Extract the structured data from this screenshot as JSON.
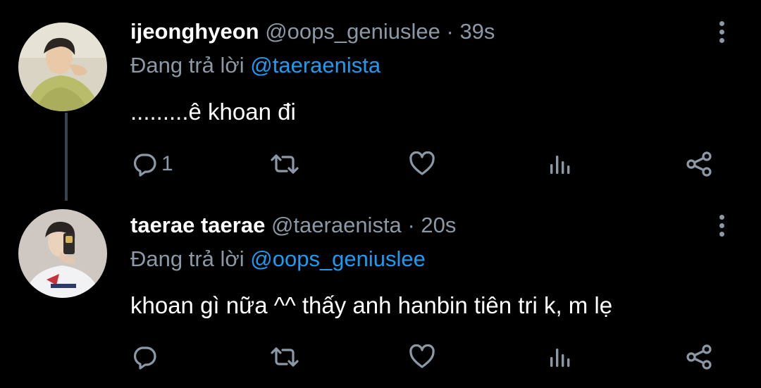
{
  "tweets": [
    {
      "display_name": "ijeonghyeon",
      "handle": "@oops_geniuslee",
      "separator": "·",
      "time": "39s",
      "replying_prefix": "Đang trả lời",
      "replying_to": "@taeraenista",
      "text": ".........ê khoan đi",
      "reply_count": "1",
      "retweet_count": "",
      "like_count": ""
    },
    {
      "display_name": "taerae taerae",
      "handle": "@taeraenista",
      "separator": "·",
      "time": "20s",
      "replying_prefix": "Đang trả lời",
      "replying_to": "@oops_geniuslee",
      "text": "khoan gì nữa ^^ thấy anh hanbin tiên tri k, m lẹ",
      "reply_count": "",
      "retweet_count": "",
      "like_count": ""
    }
  ],
  "icons": {
    "reply": "reply-icon",
    "retweet": "retweet-icon",
    "like": "heart-icon",
    "stats": "analytics-icon",
    "share": "share-icon",
    "more": "more-vertical-icon"
  },
  "colors": {
    "background": "#000000",
    "text": "#ffffff",
    "muted": "#8b98a5",
    "mention": "#1d9bf0",
    "thread_line": "#38444d"
  }
}
